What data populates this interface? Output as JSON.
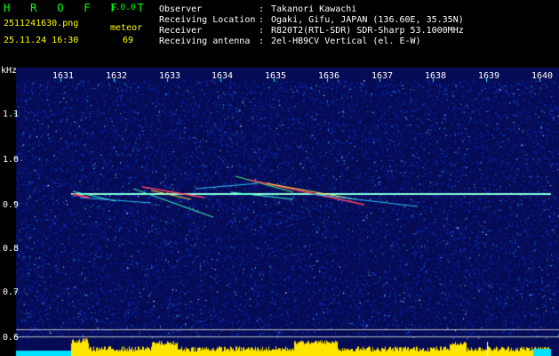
{
  "header": {
    "app_title": "H R O F F T",
    "version": "1.0.0",
    "filename": "2511241630.png",
    "datetime": "25.11.24 16:30",
    "mode_label": "meteor",
    "count": "69"
  },
  "info": [
    {
      "label": "Observer",
      "value": "Takanori Kawachi"
    },
    {
      "label": "Receiving Location",
      "value": "Ogaki, Gifu, JAPAN (136.60E, 35.35N)"
    },
    {
      "label": "Receiver",
      "value": "R820T2(RTL-SDR) SDR-Sharp 53.1000MHz"
    },
    {
      "label": "Receiving antenna",
      "value": "2el-HB9CV Vertical (el. E-W)"
    }
  ],
  "info_separator": ":",
  "axes": {
    "unit": "kHz",
    "time_ticks": [
      "1631",
      "1632",
      "1633",
      "1634",
      "1635",
      "1636",
      "1637",
      "1638",
      "1639",
      "1640"
    ],
    "freq_ticks": [
      "1.1",
      "1.0",
      "0.9",
      "0.8",
      "0.7",
      "0.6"
    ]
  },
  "colors": {
    "background": "#000000",
    "noise": "#0a1da0",
    "carrier": "#7fffe0",
    "meteor": "#ff4040",
    "histogram_yellow": "#ffe600",
    "histogram_cyan": "#00e0ff",
    "ticks": "#00ffff",
    "header_green": "#00ff00",
    "header_yellow": "#ffff00",
    "text": "#ffffff"
  }
}
